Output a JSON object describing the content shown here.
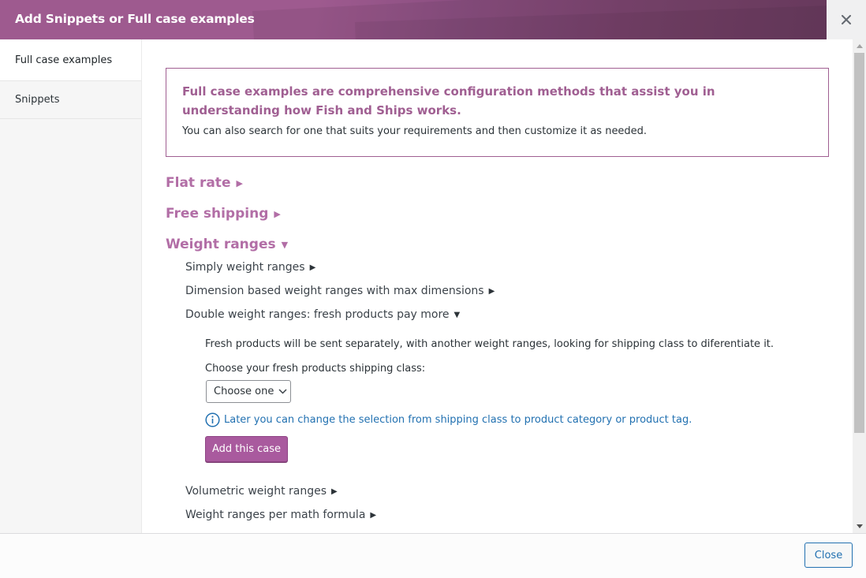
{
  "dialog": {
    "title": "Add Snippets or Full case examples",
    "close_icon": "close-x-icon"
  },
  "sidebar": {
    "items": [
      {
        "label": "Full case examples",
        "active": true
      },
      {
        "label": "Snippets",
        "active": false
      }
    ]
  },
  "intro": {
    "lead": "Full case examples are comprehensive configuration methods that assist you in understanding how Fish and Ships works.",
    "text": "You can also search for one that suits your requirements and then customize it as needed."
  },
  "categories": [
    {
      "label": "Flat rate",
      "expanded": false,
      "arrow": "▶"
    },
    {
      "label": "Free shipping",
      "expanded": false,
      "arrow": "▶"
    },
    {
      "label": "Weight ranges",
      "expanded": true,
      "arrow": "▼"
    }
  ],
  "weight_ranges": {
    "items": [
      {
        "label": "Simply weight ranges",
        "expanded": false,
        "arrow": "▶"
      },
      {
        "label": "Dimension based weight ranges with max dimensions",
        "expanded": false,
        "arrow": "▶"
      },
      {
        "label": "Double weight ranges: fresh products pay more",
        "expanded": true,
        "arrow": "▼"
      },
      {
        "label": "Volumetric weight ranges",
        "expanded": false,
        "arrow": "▶"
      },
      {
        "label": "Weight ranges per math formula",
        "expanded": false,
        "arrow": "▶"
      }
    ],
    "expanded_case": {
      "description": "Fresh products will be sent separately, with another weight ranges, looking for shipping class to diferentiate it.",
      "select_label": "Choose your fresh products shipping class:",
      "select_value": "Choose one",
      "info_text": "Later you can change the selection from shipping class to product category or product tag.",
      "add_button": "Add this case"
    }
  },
  "footer": {
    "close_button": "Close"
  },
  "colors": {
    "brand_purple": "#9e5a8f",
    "category_purple": "#b26ea6",
    "button_purple": "#a95a9e",
    "link_blue": "#2271b1"
  }
}
